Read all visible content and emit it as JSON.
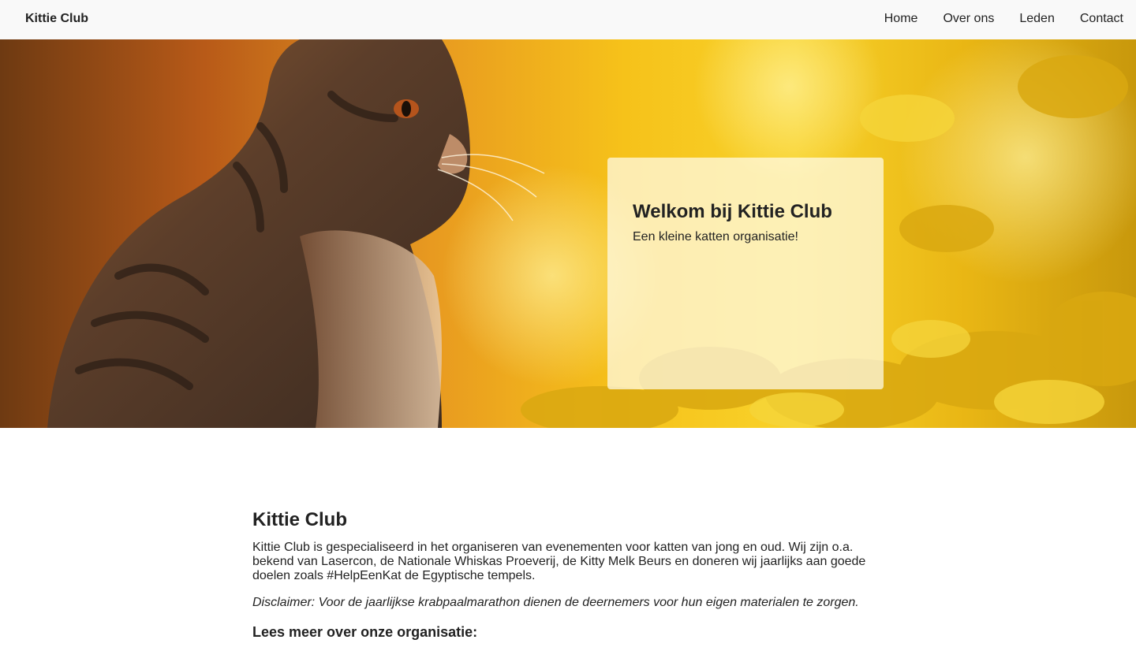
{
  "nav": {
    "brand": "Kittie Club",
    "links": [
      "Home",
      "Over ons",
      "Leden",
      "Contact"
    ]
  },
  "hero": {
    "image": "tabby-cat-in-yellow-meadow",
    "card_title": "Welkom bij Kittie Club",
    "card_subtitle": "Een kleine katten organisatie!"
  },
  "main": {
    "title": "Kittie Club",
    "intro": "Kittie Club is gespecialiseerd in het organiseren van evenementen voor katten van jong en oud. Wij zijn o.a. bekend van Lasercon, de Nationale Whiskas Proeverij, de Kitty Melk Beurs en doneren wij jaarlijks aan goede doelen zoals #HelpEenKat de Egyptische tempels.",
    "disclaimer": "Disclaimer: Voor de jaarlijkse krabpaalmarathon dienen de deernemers voor hun eigen materialen te zorgen.",
    "read_more_heading": "Lees meer over onze organisatie:"
  }
}
